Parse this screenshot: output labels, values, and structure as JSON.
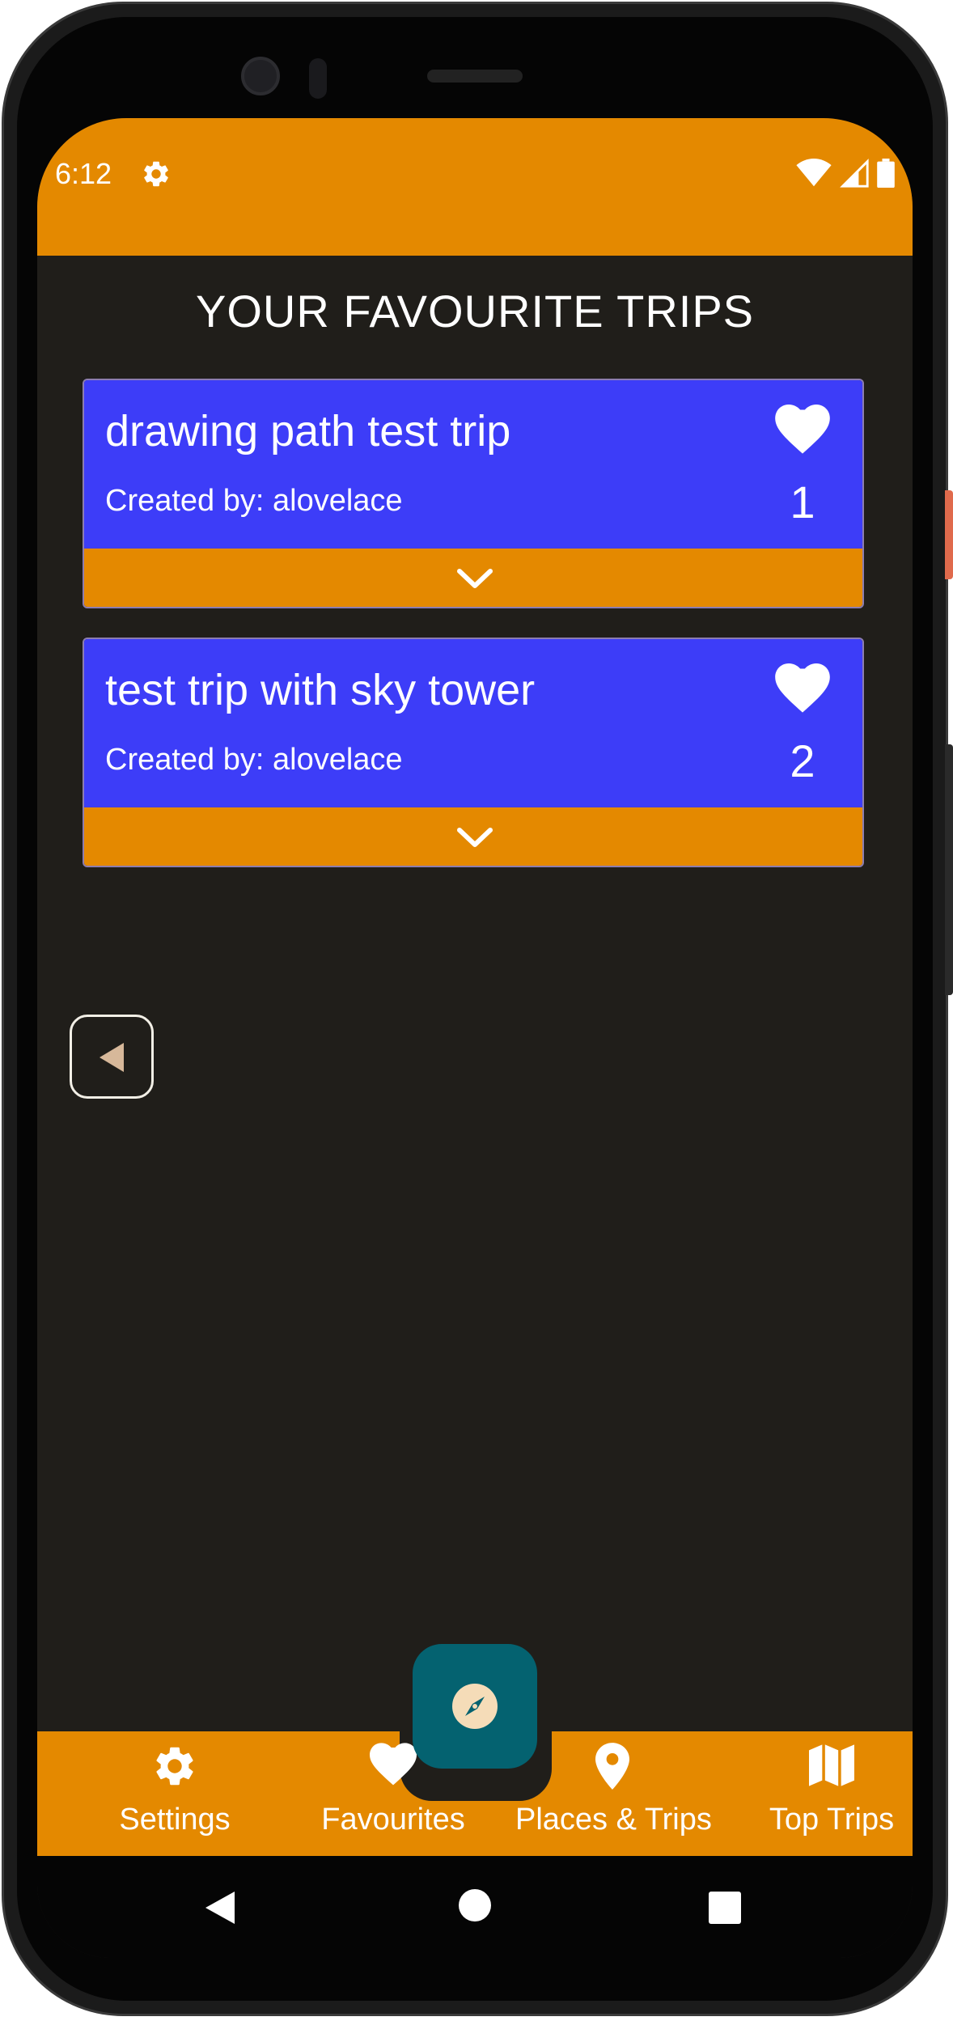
{
  "status_bar": {
    "time": "6:12",
    "icons": [
      "settings-icon",
      "wifi-icon",
      "cell-signal-icon",
      "battery-icon"
    ],
    "background": "#e48900"
  },
  "page": {
    "title": "YOUR FAVOURITE TRIPS"
  },
  "trips": [
    {
      "name": "drawing path test trip",
      "creator": "Created by: alovelace",
      "likes": "1"
    },
    {
      "name": "test trip with sky tower",
      "creator": "Created by: alovelace",
      "likes": "2"
    }
  ],
  "bottom_nav": {
    "items": [
      {
        "label": "Settings",
        "icon": "gear-icon"
      },
      {
        "label": "Favourites",
        "icon": "heart-icon"
      },
      {
        "label": "Places & Trips",
        "icon": "map-pin-icon"
      },
      {
        "label": "Top Trips",
        "icon": "map-icon"
      }
    ],
    "fab_icon": "compass-icon"
  },
  "colors": {
    "accent_orange": "#e48900",
    "card_blue": "#3d3df8",
    "background": "#201e1a",
    "fab_teal": "#046270"
  }
}
